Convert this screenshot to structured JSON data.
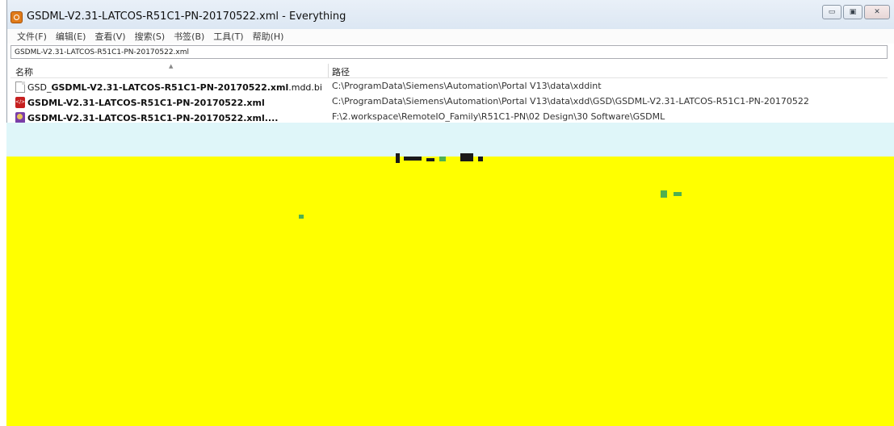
{
  "window": {
    "title": "GSDML-V2.31-LATCOS-R51C1-PN-20170522.xml - Everything",
    "controls": [
      "minimize",
      "maximize",
      "close"
    ]
  },
  "menu": [
    {
      "label": "文件(F)"
    },
    {
      "label": "编辑(E)"
    },
    {
      "label": "查看(V)"
    },
    {
      "label": "搜索(S)"
    },
    {
      "label": "书签(B)"
    },
    {
      "label": "工具(T)"
    },
    {
      "label": "帮助(H)"
    }
  ],
  "search": {
    "value": "GSDML-V2.31-LATCOS-R51C1-PN-20170522.xml"
  },
  "columns": {
    "name": "名称",
    "path": "路径"
  },
  "rows": [
    {
      "icon": "file-icon",
      "name_prefix": "GSD_",
      "name_bold": "GSDML-V2.31-LATCOS-R51C1-PN-20170522.xml",
      "name_suffix": ".mdd.bindll",
      "path": "C:\\ProgramData\\Siemens\\Automation\\Portal V13\\data\\xddint"
    },
    {
      "icon": "xml-icon",
      "name_prefix": "",
      "name_bold": "GSDML-V2.31-LATCOS-R51C1-PN-20170522.xml",
      "name_suffix": "",
      "path": "C:\\ProgramData\\Siemens\\Automation\\Portal V13\\data\\xdd\\GSD\\GSDML-V2.31-LATCOS-R51C1-PN-20170522"
    },
    {
      "icon": "image-icon",
      "name_prefix": "",
      "name_bold": "GSDML-V2.31-LATCOS-R51C1-PN-20170522.xml....",
      "name_suffix": "",
      "path": "F:\\2.workspace\\RemoteIO_Family\\R51C1-PN\\02 Design\\30 Software\\GSDML"
    }
  ],
  "colors": {
    "overlay": "#ffff00",
    "overlay_band": "#dff6f9",
    "title_bar": "#dce7f3"
  }
}
